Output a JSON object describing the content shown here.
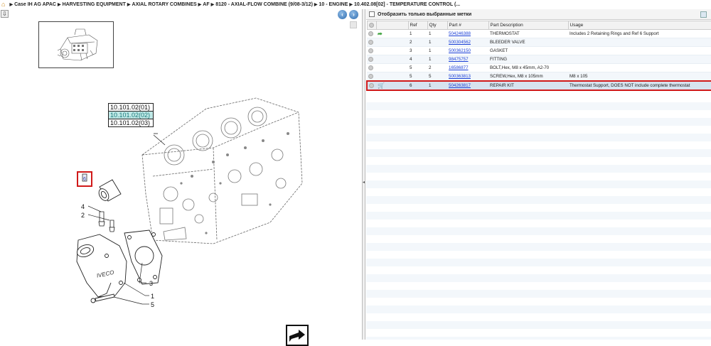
{
  "breadcrumb": {
    "items": [
      "Case IH AG APAC",
      "HARVESTING EQUIPMENT",
      "AXIAL ROTARY COMBINES",
      "AF",
      "8120 - AXIAL-FLOW COMBINE (9/08-3/12)",
      "10 - ENGINE",
      "10.402.08[02] - TEMPERATURE CONTROL (..."
    ]
  },
  "diagram": {
    "callouts": [
      "10.101.02(01)",
      "10.101.02(02)",
      "10.101.02(03)"
    ],
    "ref_labels": {
      "r4": "4",
      "r2": "2",
      "r3": "3",
      "r1": "1",
      "r5": "5",
      "r6": "6"
    },
    "brand_mark": "IVECO"
  },
  "filter": {
    "label": "Отобразить только выбранные метки"
  },
  "table": {
    "columns": [
      "",
      "",
      "Ref",
      "Qty",
      "Part #",
      "Part Description",
      "Usage"
    ],
    "rows": [
      {
        "ref": "1",
        "qty": "1",
        "part": "504246388",
        "desc": "THERMOSTAT",
        "usage": "Includes 2 Retaining Rings and Ref 6 Support",
        "icon": "green-arrow-icon"
      },
      {
        "ref": "2",
        "qty": "1",
        "part": "500304562",
        "desc": "BLEEDER VALVE",
        "usage": "",
        "icon": ""
      },
      {
        "ref": "3",
        "qty": "1",
        "part": "500362150",
        "desc": "GASKET",
        "usage": "",
        "icon": ""
      },
      {
        "ref": "4",
        "qty": "1",
        "part": "98475757",
        "desc": "FITTING",
        "usage": "",
        "icon": ""
      },
      {
        "ref": "5",
        "qty": "2",
        "part": "16586877",
        "desc": "BOLT,Hex, M8 x 45mm, A2-70",
        "usage": "",
        "icon": ""
      },
      {
        "ref": "5",
        "qty": "5",
        "part": "500363813",
        "desc": "SCREW,Hex, M8 x 105mm",
        "usage": "M8 x 105",
        "icon": ""
      },
      {
        "ref": "6",
        "qty": "1",
        "part": "504263817",
        "desc": "REPAIR KIT",
        "usage": "Thermostat Support, DOES NOT include complete thermostat",
        "icon": "cart-icon"
      }
    ]
  },
  "colors": {
    "highlight_border": "#d01a1a",
    "selected_callout_bg": "#bfe8e6",
    "link": "#1a3fd6"
  }
}
